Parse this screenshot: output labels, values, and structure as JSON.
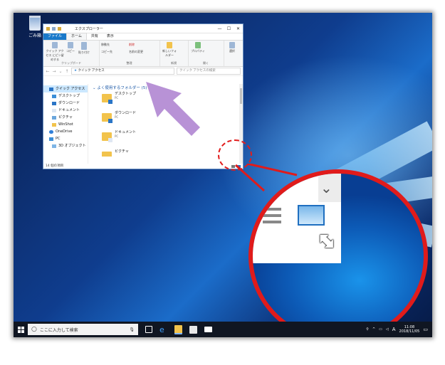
{
  "desktop": {
    "recycle_bin_label": "ごみ箱"
  },
  "explorer": {
    "title": "エクスプローラー",
    "controls": {
      "minimize": "—",
      "maximize": "☐",
      "close": "✕"
    },
    "tabs": [
      "ファイル",
      "ホーム",
      "共有",
      "表示"
    ],
    "ribbon": {
      "clipboard_label": "クリップボード",
      "organize_label": "整理",
      "new_label": "新規",
      "open_label": "開く",
      "pin": "クイック アクセス にピン留めする",
      "copy": "コピー",
      "paste": "貼り付け",
      "move_to": "移動先",
      "delete": "削除",
      "copy_to": "コピー先",
      "rename": "名前の変更",
      "new_folder": "新しいフォルダー",
      "properties": "プロパティ",
      "select": "選択"
    },
    "address": "クイック アクセス",
    "search_placeholder": "クイック アクセスの検索",
    "nav_pane": [
      "クイック アクセス",
      "デスクトップ",
      "ダウンロード",
      "ドキュメント",
      "ピクチャ",
      "WinShot",
      "OneDrive",
      "PC",
      "3D オブジェクト"
    ],
    "group_heading": "よく使用するフォルダー (5)",
    "folders": [
      {
        "name": "デスクトップ",
        "location": "PC"
      },
      {
        "name": "ダウンロード",
        "location": "PC"
      },
      {
        "name": "ドキュメント",
        "location": "PC"
      },
      {
        "name": "ピクチャ",
        "location": ""
      }
    ],
    "status_text": "14 個の項目"
  },
  "taskbar": {
    "search_placeholder": "ここに入力して検索",
    "ime": "A",
    "time": "11:08",
    "date": "2018/11/05"
  },
  "colors": {
    "accent": "#1979ca",
    "highlight_red": "#e01b1b",
    "arrow_purple": "#b892d6"
  }
}
